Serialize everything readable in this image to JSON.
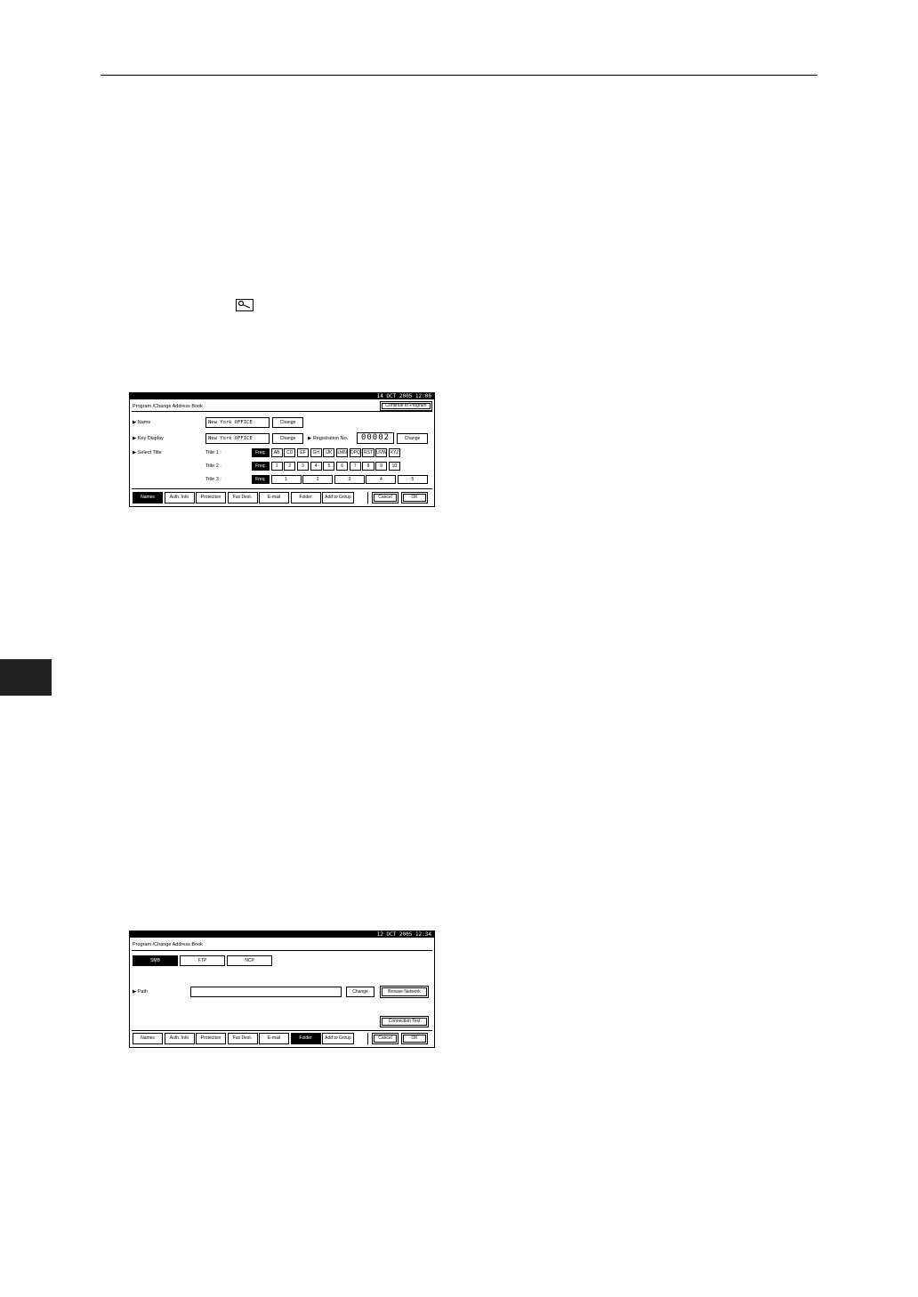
{
  "screen1": {
    "datetime": "14  OCT   2005 12:00",
    "title": "Program /Change Address Book",
    "continue_label": "Continue to Program",
    "name_label": "▶ Name",
    "name_value": "New York OFFICE",
    "key_display_label": "▶ Key Display",
    "key_display_value": "New York OFFICE",
    "change_label": "Change",
    "regno_label": "▶ Registration No.",
    "regno_value": "00002",
    "select_title_label": "▶ Select Title",
    "title1_label": "Title  1 :",
    "title2_label": "Title  2 :",
    "title3_label": "Title  3 :",
    "title1_keys": [
      "Freq.",
      "AB",
      "CD",
      "EF",
      "GH",
      "IJK",
      "LMN",
      "OPQ",
      "RST",
      "UVW",
      "XYZ"
    ],
    "title2_keys": [
      "Freq.",
      "1",
      "2",
      "3",
      "4",
      "5",
      "6",
      "7",
      "8",
      "9",
      "10"
    ],
    "title3_keys": [
      "Freq.",
      "1",
      "2",
      "3",
      "4",
      "5"
    ],
    "tabs": [
      "Names",
      "Auth. Info",
      "Protection",
      "Fax Dest.",
      "E-mail",
      "Folder",
      "Add to Group"
    ],
    "cancel_label": "Cancel",
    "ok_label": "OK"
  },
  "screen2": {
    "datetime": "12  OCT   2005 12:34",
    "title": "Program /Change Address Book",
    "protocols": [
      "SMB",
      "FTP",
      "NCP"
    ],
    "path_label": "▶ Path",
    "path_value": "",
    "change_label": "Change",
    "browse_label": "Browse Network",
    "connection_test_label": "Connection Test",
    "tabs": [
      "Names",
      "Auth. Info",
      "Protection",
      "Fax Dest.",
      "E-mail",
      "Folder",
      "Add to Group"
    ],
    "cancel_label": "Cancel",
    "ok_label": "OK"
  }
}
